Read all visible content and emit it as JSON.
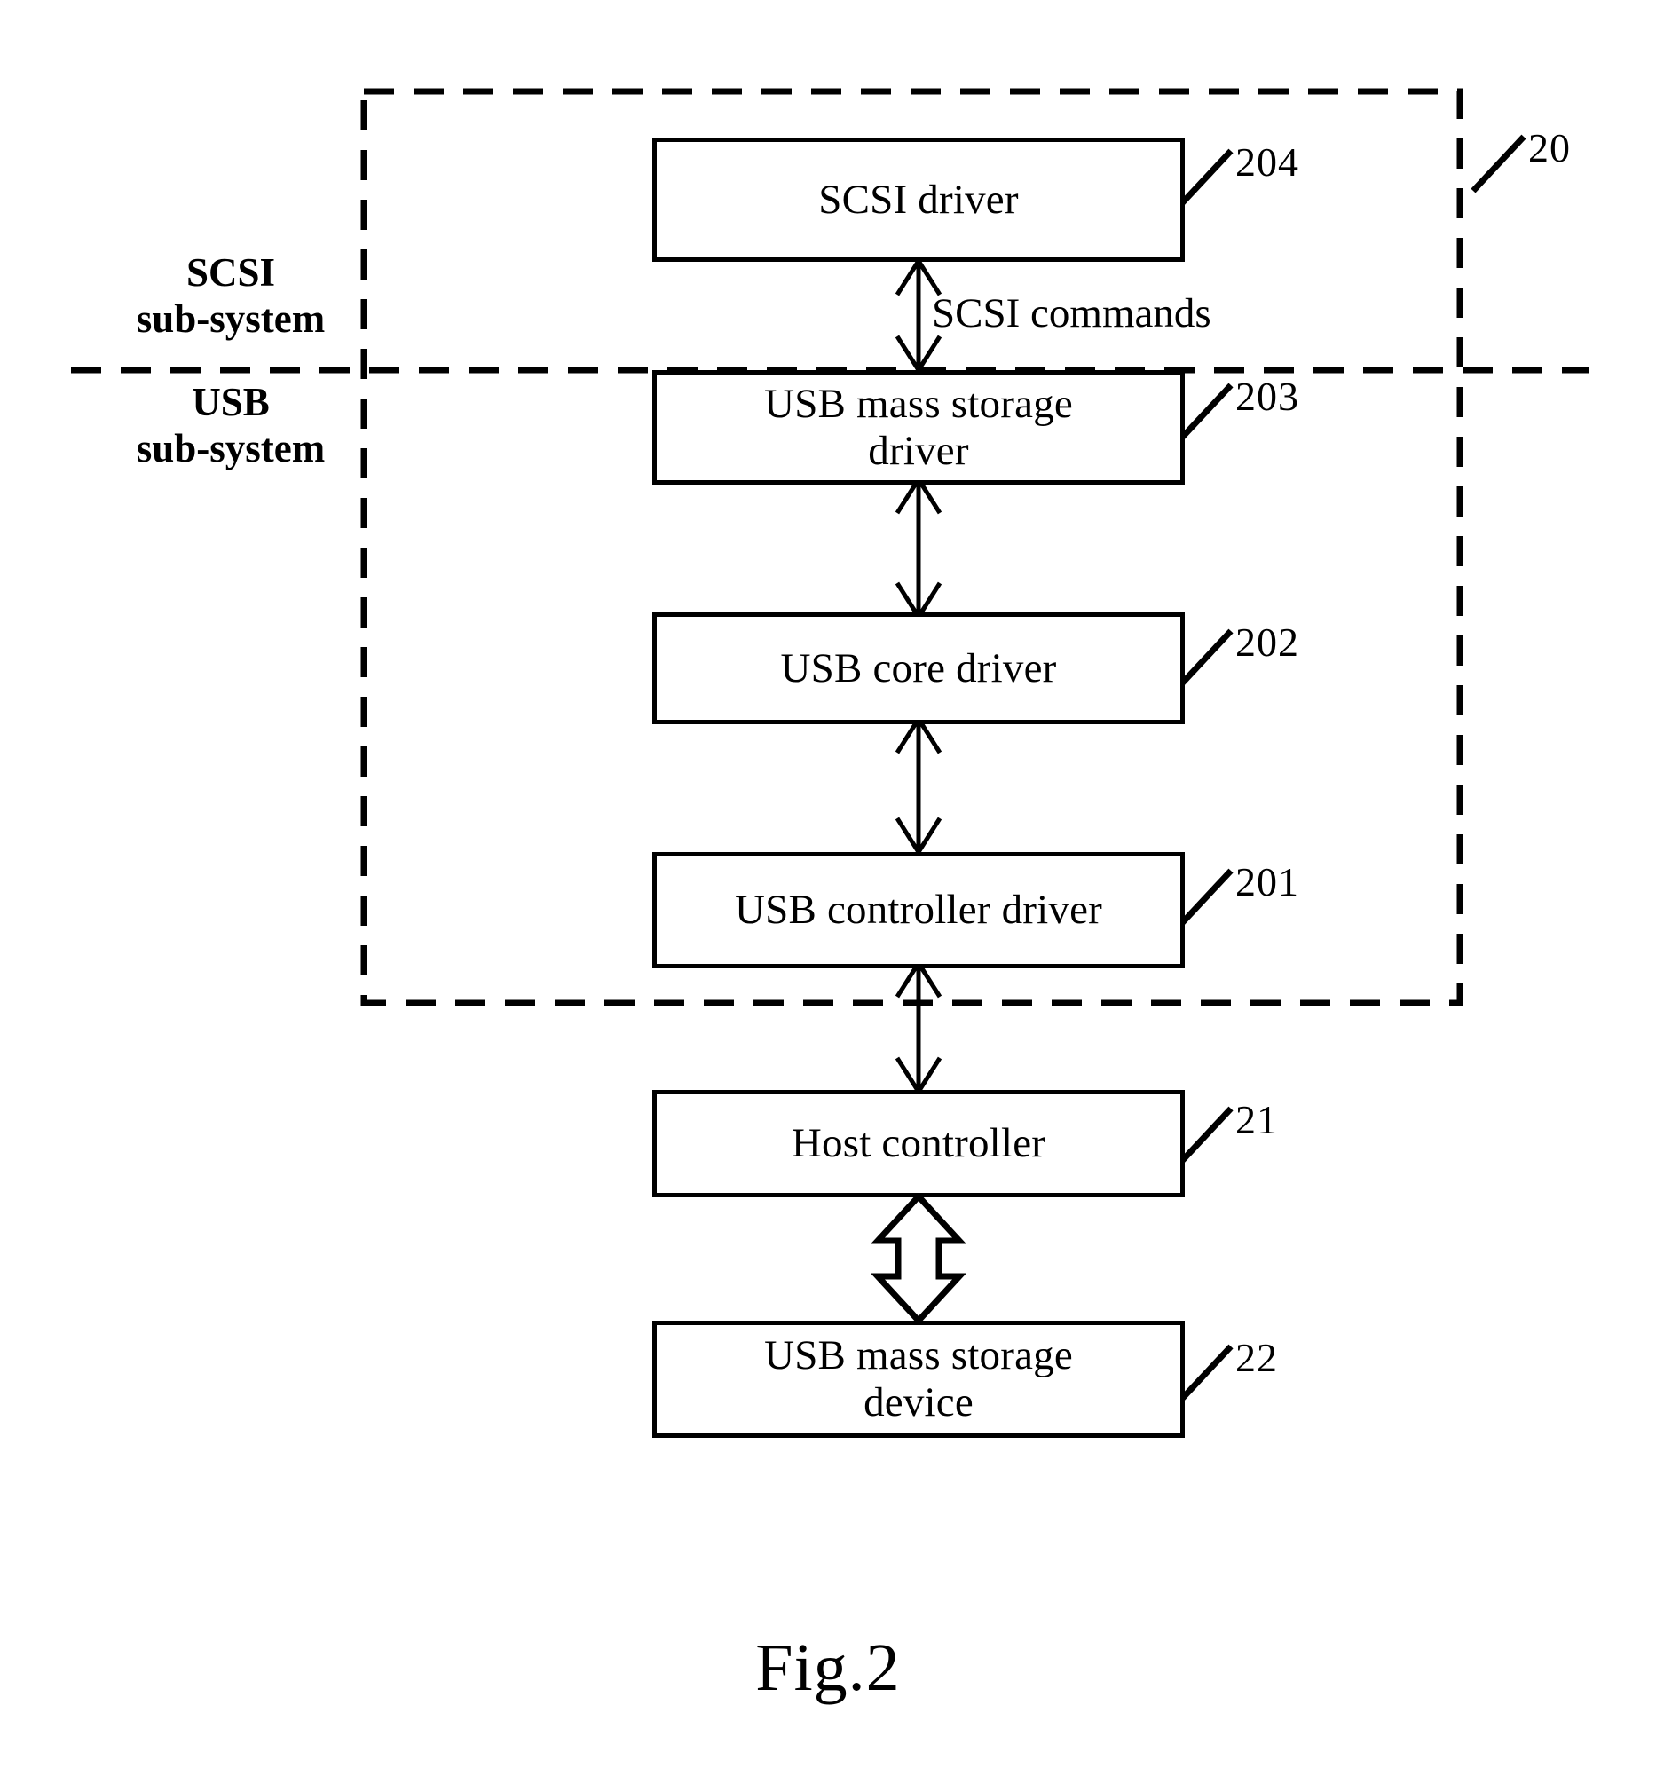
{
  "figure": {
    "caption": "Fig.2",
    "boxes": [
      {
        "id": "scsi-driver",
        "label": "SCSI driver",
        "ref": "204"
      },
      {
        "id": "usb-mass-storage-driver",
        "label": "USB mass storage\ndriver",
        "ref": "203"
      },
      {
        "id": "usb-core-driver",
        "label": "USB core driver",
        "ref": "202"
      },
      {
        "id": "usb-controller-driver",
        "label": "USB controller driver",
        "ref": "201"
      },
      {
        "id": "host-controller",
        "label": "Host controller",
        "ref": "21"
      },
      {
        "id": "usb-mass-storage-device",
        "label": "USB mass storage\ndevice",
        "ref": "22"
      }
    ],
    "groups": [
      {
        "id": "driver-stack",
        "ref": "20"
      }
    ],
    "side_labels": [
      {
        "id": "scsi-subsystem",
        "line1": "SCSI",
        "line2": "sub-system"
      },
      {
        "id": "usb-subsystem",
        "line1": "USB",
        "line2": "sub-system"
      }
    ],
    "edge_labels": [
      {
        "id": "scsi-commands",
        "label": "SCSI commands"
      }
    ],
    "colors": {
      "stroke": "#000000",
      "background": "#ffffff"
    }
  }
}
